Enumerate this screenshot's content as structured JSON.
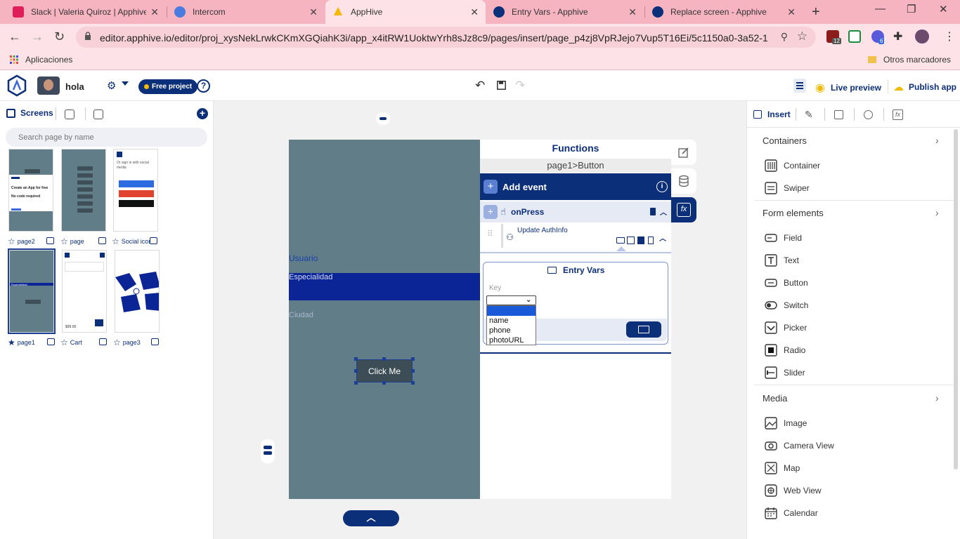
{
  "browser": {
    "tabs": [
      {
        "title": "Slack | Valeria Quiroz | Apphive",
        "favicon_color": "#e01e5a"
      },
      {
        "title": "Intercom",
        "favicon_color": "#4a7be0"
      },
      {
        "title": "AppHive",
        "favicon_color": "#f5b800"
      },
      {
        "title": "Entry Vars - Apphive",
        "favicon_color": "#0c2f7a"
      },
      {
        "title": "Replace screen - Apphive",
        "favicon_color": "#0c2f7a"
      }
    ],
    "url": "editor.apphive.io/editor/proj_xysNekLrwkCKmXGQiahK3i/app_x4itRW1UoktwYrh8sJz8c9/pages/insert/page_p4zj8VpRJejo7Vup5T16Ei/5c1150a0-3a52-1...",
    "bookmarks": {
      "apps": "Aplicaciones",
      "other": "Otros marcadores"
    },
    "ext_badges": {
      "first": "12",
      "second": "6"
    }
  },
  "header": {
    "project_name": "hola",
    "badge": "Free project",
    "live_preview": "Live preview",
    "publish": "Publish app"
  },
  "left_panel": {
    "tab_screens": "Screens",
    "search_placeholder": "Search page by name",
    "pages": [
      {
        "name": "page2"
      },
      {
        "name": "page"
      },
      {
        "name": "Social icon"
      },
      {
        "name": "page1"
      },
      {
        "name": "Cart"
      },
      {
        "name": "page3"
      }
    ],
    "thumb_texts": {
      "create_app": "Create an App for free",
      "no_code": "No code required",
      "click_me": "Click Me",
      "social_sign": "Or sign in with social media",
      "price": "$99.00",
      "especialidad": "Especialidad"
    }
  },
  "phone": {
    "usuario": "Usuario",
    "especialidad": "Especialidad",
    "ciudad": "Ciudad",
    "button": "Click Me"
  },
  "functions": {
    "title": "Functions",
    "path": "page1>Button",
    "add_event": "Add event",
    "event_name": "onPress",
    "action": "Update AuthInfo",
    "entry_title": "Entry Vars",
    "key_label": "Key",
    "options": [
      "",
      "name",
      "phone",
      "photoURL"
    ]
  },
  "right_panel": {
    "insert_tab": "Insert",
    "sections": [
      {
        "title": "Containers",
        "items": [
          "Container",
          "Swiper"
        ]
      },
      {
        "title": "Form elements",
        "items": [
          "Field",
          "Text",
          "Button",
          "Switch",
          "Picker",
          "Radio",
          "Slider"
        ]
      },
      {
        "title": "Media",
        "items": [
          "Image",
          "Camera View",
          "Map",
          "Web View",
          "Calendar"
        ]
      }
    ]
  },
  "colors": {
    "brand": "#0c2f7a",
    "tab_bar": "#f6b4c0",
    "toolbar": "#fde3e8",
    "phone_bg": "#617d88",
    "phone_accent": "#0c2596",
    "badge_dot": "#f5b800"
  }
}
